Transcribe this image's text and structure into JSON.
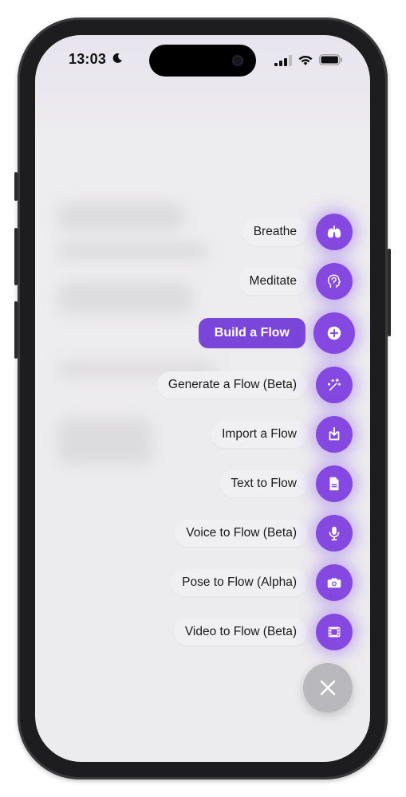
{
  "status_bar": {
    "time": "13:03",
    "icons": [
      "moon-icon",
      "signal-icon",
      "wifi-icon",
      "battery-icon"
    ]
  },
  "menu": {
    "items": [
      {
        "label": "Breathe",
        "icon": "lungs-icon",
        "active": false
      },
      {
        "label": "Meditate",
        "icon": "head-brain-icon",
        "active": false
      },
      {
        "label": "Build a Flow",
        "icon": "plus-circle-icon",
        "active": true
      },
      {
        "label": "Generate a Flow (Beta)",
        "icon": "magic-wand-icon",
        "active": false
      },
      {
        "label": "Import a Flow",
        "icon": "import-icon",
        "active": false
      },
      {
        "label": "Text to Flow",
        "icon": "document-icon",
        "active": false
      },
      {
        "label": "Voice to Flow (Beta)",
        "icon": "microphone-icon",
        "active": false
      },
      {
        "label": "Pose to Flow (Alpha)",
        "icon": "camera-icon",
        "active": false
      },
      {
        "label": "Video to Flow (Beta)",
        "icon": "film-icon",
        "active": false
      }
    ],
    "close_icon": "close-icon"
  },
  "colors": {
    "accent": "#8548e0",
    "active_pill": "#7a45d9",
    "close_button": "#b9b8bd",
    "screen_bg": "#ecebed"
  }
}
